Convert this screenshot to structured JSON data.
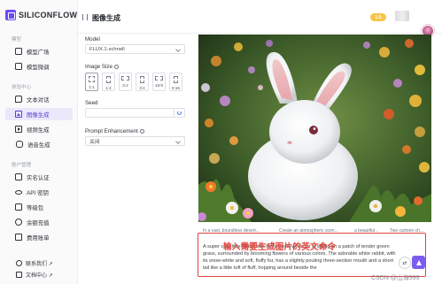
{
  "app": {
    "brand": "SILICONFLOW",
    "page_title": "图像生成"
  },
  "sidebar": {
    "groups": [
      "模型",
      "体验中心",
      "账户管理"
    ],
    "items": [
      {
        "label": "模型广场",
        "icon": "box-icon"
      },
      {
        "label": "模型微调",
        "icon": "cube-icon"
      },
      {
        "label": "文本对话",
        "icon": "chat-icon"
      },
      {
        "label": "图像生成",
        "icon": "image-icon",
        "active": true
      },
      {
        "label": "视频生成",
        "icon": "video-icon"
      },
      {
        "label": "语音生成",
        "icon": "mic-icon"
      },
      {
        "label": "实名认证",
        "icon": "id-icon"
      },
      {
        "label": "API 密钥",
        "icon": "key-icon"
      },
      {
        "label": "等级包",
        "icon": "package-icon"
      },
      {
        "label": "余额充值",
        "icon": "wallet-icon"
      },
      {
        "label": "费用账单",
        "icon": "bill-icon"
      }
    ],
    "footer": [
      {
        "label": "联系我们 ↗",
        "icon": "contact-icon"
      },
      {
        "label": "文档中心 ↗",
        "icon": "doc-icon"
      }
    ]
  },
  "header": {
    "badge": "1.0"
  },
  "form": {
    "model_label": "Model",
    "model_value": "FLUX.1-schnell",
    "size_label": "Image Size",
    "sizes": [
      "1:1",
      "1:2",
      "3:2",
      "3:4",
      "16:9",
      "9:16"
    ],
    "seed_label": "Seed",
    "seed_value": "",
    "prompt_enh_label": "Prompt Enhancement",
    "prompt_enh_value": "关闭"
  },
  "suggestions": [
    "In a vast, boundless desert...",
    "Create an atmospheric scen...",
    "a beautiful...",
    "Two cartoon ch..."
  ],
  "prompt": {
    "annotation": "输入需要生成图片的英文命令",
    "text": "A super cute little rabbit with fluffy, snow-white fur is sitting on a patch of tender green grass, surrounded by blooming flowers of various colors. The adorable white rabbit, with its snow-white and soft, fluffy fur, has a slightly pouting three-section mouth and a short tail like a little tuft of fluff, hopping around beside the"
  },
  "watermark": "CSDN @山海999",
  "colors": {
    "accent": "#7c5cf0",
    "active_bg": "#ece8fb",
    "annotation": "#e0433a",
    "badge": "#f6c545"
  }
}
